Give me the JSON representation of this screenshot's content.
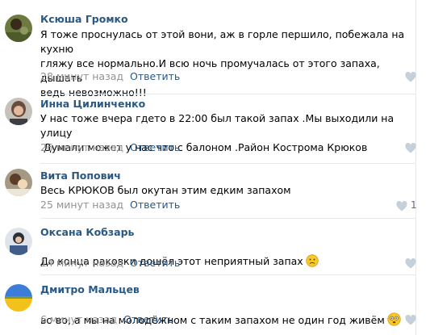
{
  "comments": [
    {
      "author": "Ксюша Громко",
      "text": "Я тоже проснулась от этой вони, аж в горле першило, побежала на кухню\nгляжу все нормально.И всю ночь промучалась от этого запаха, дышать\nведь невозможно!!!",
      "time": "28 минут назад",
      "reply": "Ответить",
      "likes": ""
    },
    {
      "author": "Инна Цилинченко",
      "text": "У нас тоже вчера гдето в 22:00 был такой запах .Мы выходили на улицу\n.Думали может у нас что с балоном .Район Кострома Крюков",
      "time": "26 минут назад",
      "reply": "Ответить",
      "likes": ""
    },
    {
      "author": "Вита Попович",
      "text": "Весь КРЮКОВ был окутан этим едким запахом",
      "time": "25 минут назад",
      "reply": "Ответить",
      "likes": "1"
    },
    {
      "author": "Оксана Кобзарь",
      "text": "До конца раковки дошёл этот неприятный запах",
      "time": "14 минут назад",
      "reply": "Ответить",
      "likes": ""
    },
    {
      "author": "Дмитро Мальцев",
      "text": "во во, а мы на молодёжном с таким запахом не один год живём",
      "time": "6 минут назад",
      "reply": "Ответить",
      "likes": ""
    }
  ],
  "icons": {
    "like": "heart-icon",
    "emoji_frown": "frowning-face-emoji",
    "emoji_flushed": "flushed-face-emoji"
  },
  "colors": {
    "link": "#2a5885",
    "meta": "#939393",
    "like": "#c5d0db"
  }
}
